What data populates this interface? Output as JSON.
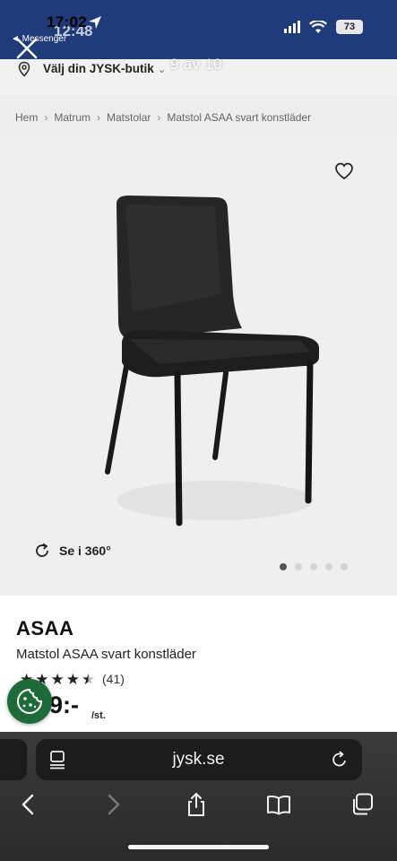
{
  "status_bar": {
    "time": "17:02",
    "time_ghost": "12:48",
    "back_app": "◄ Messenger",
    "battery": "73"
  },
  "story": {
    "counter": "9 av 10"
  },
  "header": {
    "store_selector_label": "Välj din JYSK-butik"
  },
  "breadcrumb": [
    "Hem",
    "Matrum",
    "Matstolar",
    "Matstol ASAA svart konstläder"
  ],
  "gallery": {
    "rotate_label": "Se i 360°",
    "image_count": 5,
    "active_index": 0
  },
  "product": {
    "name": "ASAA",
    "description": "Matstol ASAA svart konstläder",
    "rating": 4.5,
    "rating_count": "(41)",
    "price": "9:-",
    "price_unit": "/st."
  },
  "browser": {
    "url": "jysk.se"
  },
  "colors": {
    "status_bar_bg": "#1f3b7a",
    "cookie_button": "#1e6b3a",
    "toolbar_bg": "#2b2b2b"
  },
  "icons": {
    "wishlist": "heart-icon",
    "store": "location-pin-icon",
    "rotate": "rotate-360-icon",
    "cookie": "cookie-icon",
    "reload": "reload-icon",
    "back": "back-arrow-icon",
    "forward": "forward-arrow-icon",
    "share": "share-icon",
    "bookmarks": "book-icon",
    "tabs": "tabs-icon"
  }
}
